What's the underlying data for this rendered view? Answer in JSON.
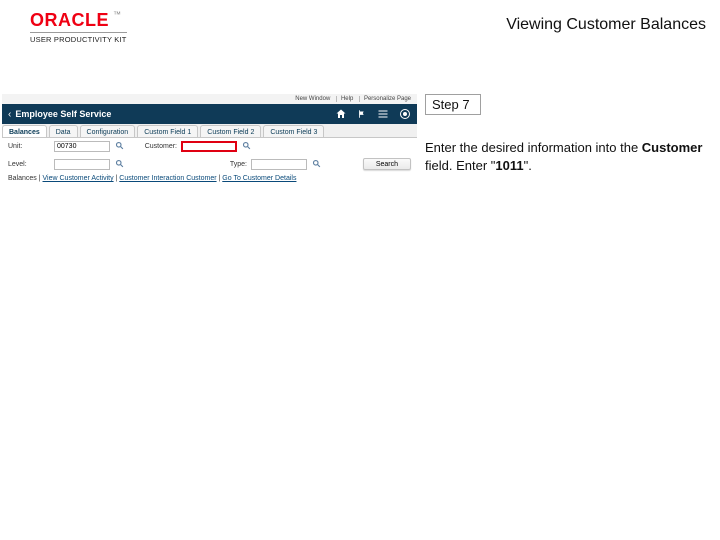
{
  "brand": {
    "name": "ORACLE",
    "tm": "™",
    "sub": "USER PRODUCTIVITY KIT"
  },
  "page_title": "Viewing Customer Balances",
  "app": {
    "utility": {
      "item1": "New Window",
      "item2": "Help",
      "item3": "Personalize Page"
    },
    "bar_title": "Employee Self Service",
    "tabs": {
      "t0": "Balances",
      "t1": "Data",
      "t2": "Configuration",
      "t3": "Custom Field 1",
      "t4": "Custom Field 2",
      "t5": "Custom Field 3"
    },
    "row1": {
      "unit_label": "Unit:",
      "unit_value": "00730",
      "customer_label": "Customer:",
      "customer_value": ""
    },
    "row2": {
      "level_label": "Level:",
      "level_value": "",
      "type_label": "Type:",
      "type_value": "",
      "search_label": "Search"
    },
    "breadcrumb": {
      "pre": "Balances | ",
      "a1": "View Customer Activity",
      "sep1": " | ",
      "a2": "Customer Interaction Customer",
      "sep2": " | ",
      "a3": "Go To Customer Details"
    }
  },
  "instructions": {
    "step_label": "Step 7",
    "line_pre": "Enter the desired information into the ",
    "field_name": "Customer",
    "line_mid": " field. Enter \"",
    "value": "1011",
    "line_post": "\"."
  }
}
